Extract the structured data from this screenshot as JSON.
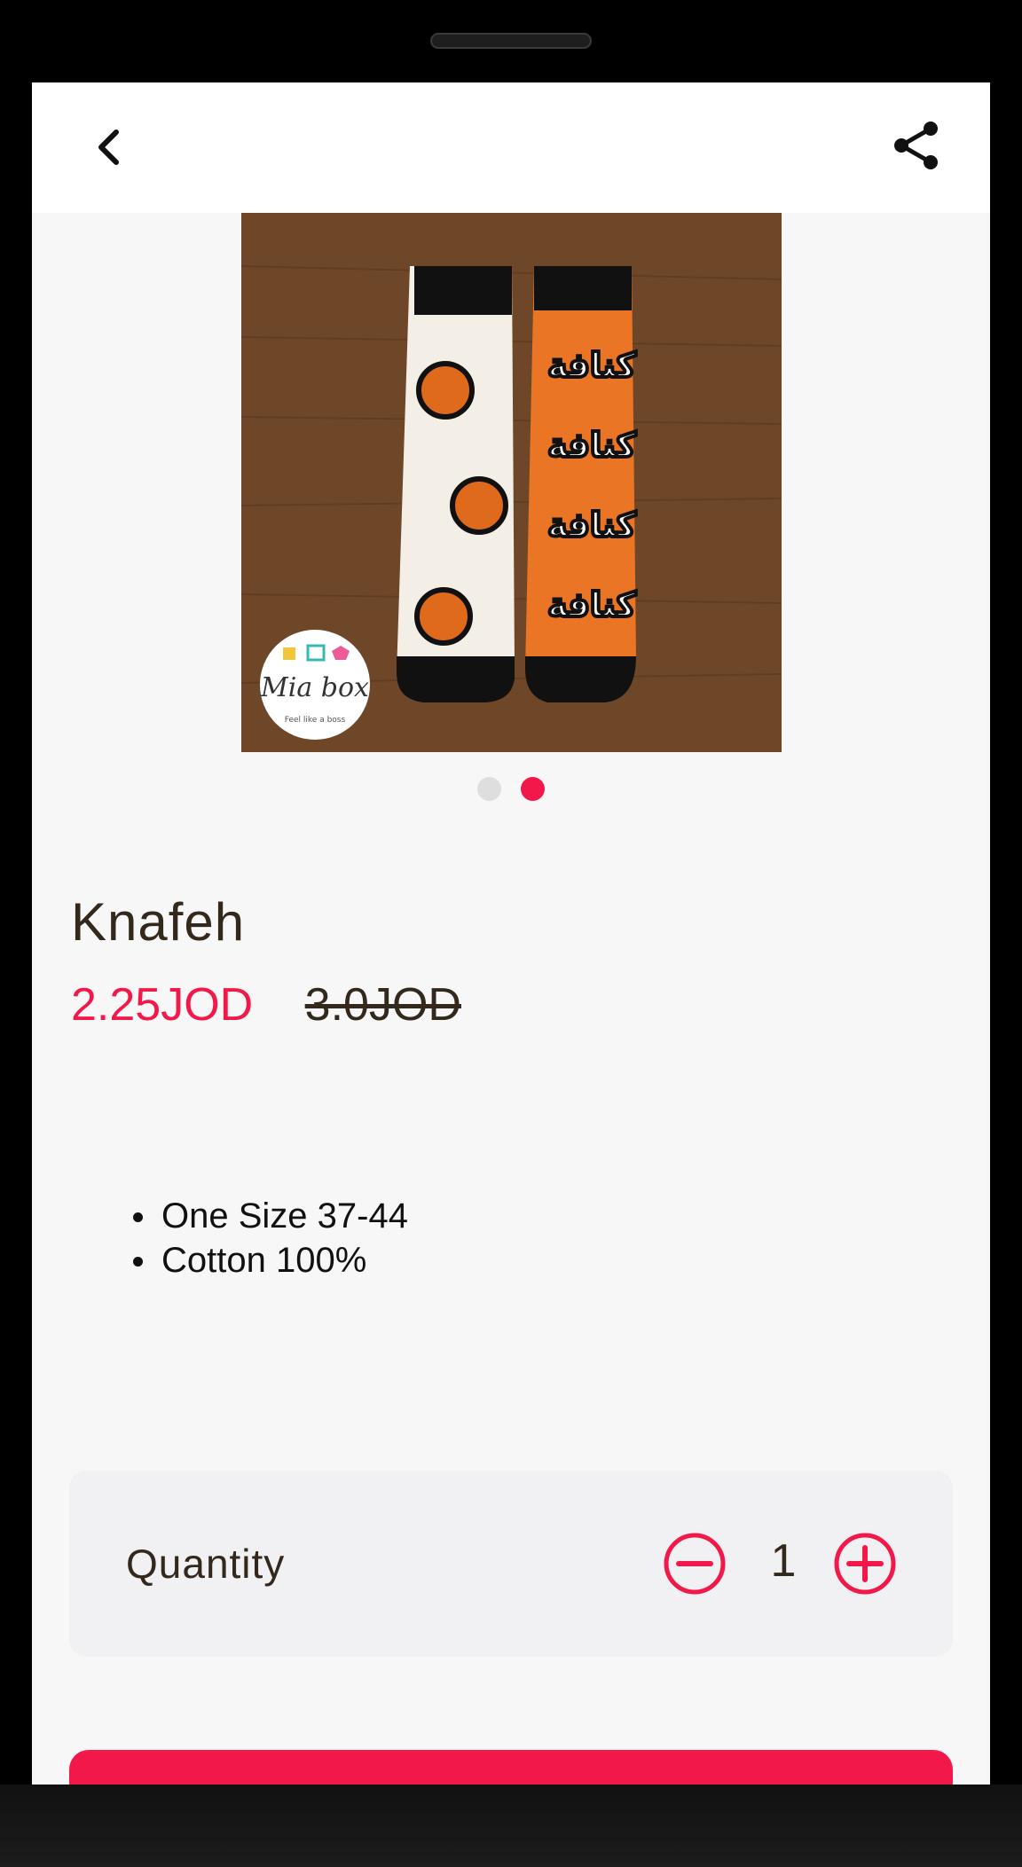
{
  "product": {
    "title": "Knafeh",
    "price": "2.25JOD",
    "old_price": "3.0JOD",
    "features": [
      "One Size 37-44",
      "Cotton 100%"
    ],
    "image": {
      "logo_text": "Mia box",
      "logo_tagline": "Feel like a boss",
      "sock_text": "كنافة"
    }
  },
  "carousel": {
    "total": 2,
    "active_index": 1
  },
  "quantity": {
    "label": "Quantity",
    "value": "1"
  },
  "colors": {
    "accent": "#f2194a",
    "text_dark": "#33281c",
    "screen_bg": "#f7f7f7",
    "card_bg": "#f1f1f3"
  },
  "icons": {
    "back": "chevron-left-icon",
    "share": "share-icon",
    "minus": "minus-circle-icon",
    "plus": "plus-circle-icon"
  }
}
